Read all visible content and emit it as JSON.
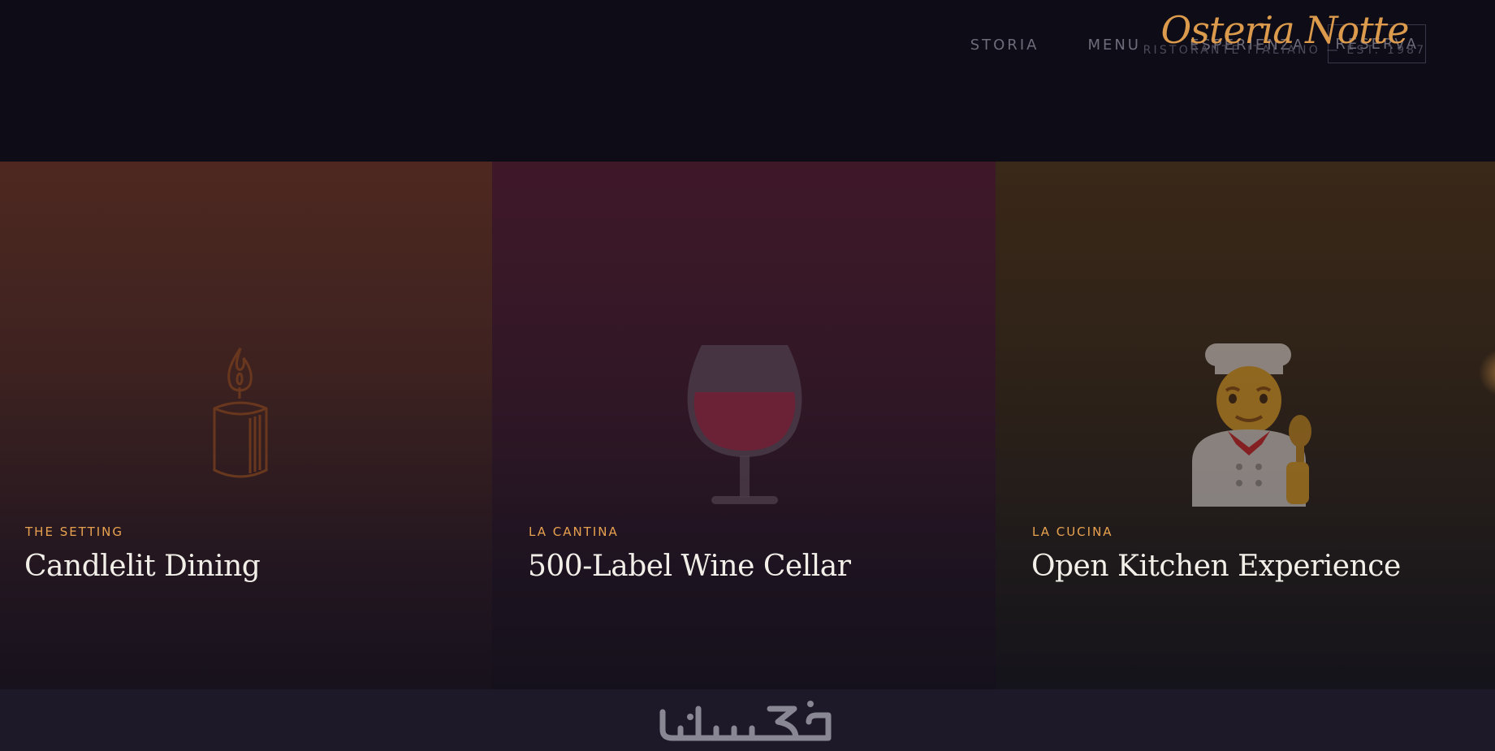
{
  "header": {
    "nav": [
      {
        "label": "STORIA"
      },
      {
        "label": "MENU"
      },
      {
        "label": "ESPERIENZA"
      },
      {
        "label": "RESERVA"
      }
    ],
    "brand": {
      "name": "Osteria Notte",
      "tagline": "RISTORANTE ITALIANO — EST. 1987"
    }
  },
  "panels": [
    {
      "eyebrow": "THE SETTING",
      "title": "Candlelit Dining",
      "icon": "candle-icon"
    },
    {
      "eyebrow": "LA CANTINA",
      "title": "500-Label Wine Cellar",
      "icon": "wine-glass-icon"
    },
    {
      "eyebrow": "LA CUCINA",
      "title": "Open Kitchen Experience",
      "icon": "chef-icon"
    }
  ],
  "footer": {
    "watermark_icon": "khamsat-logo"
  },
  "colors": {
    "accent": "#e8a24f",
    "background": "#0d0c17",
    "footer": "#1e1929"
  }
}
